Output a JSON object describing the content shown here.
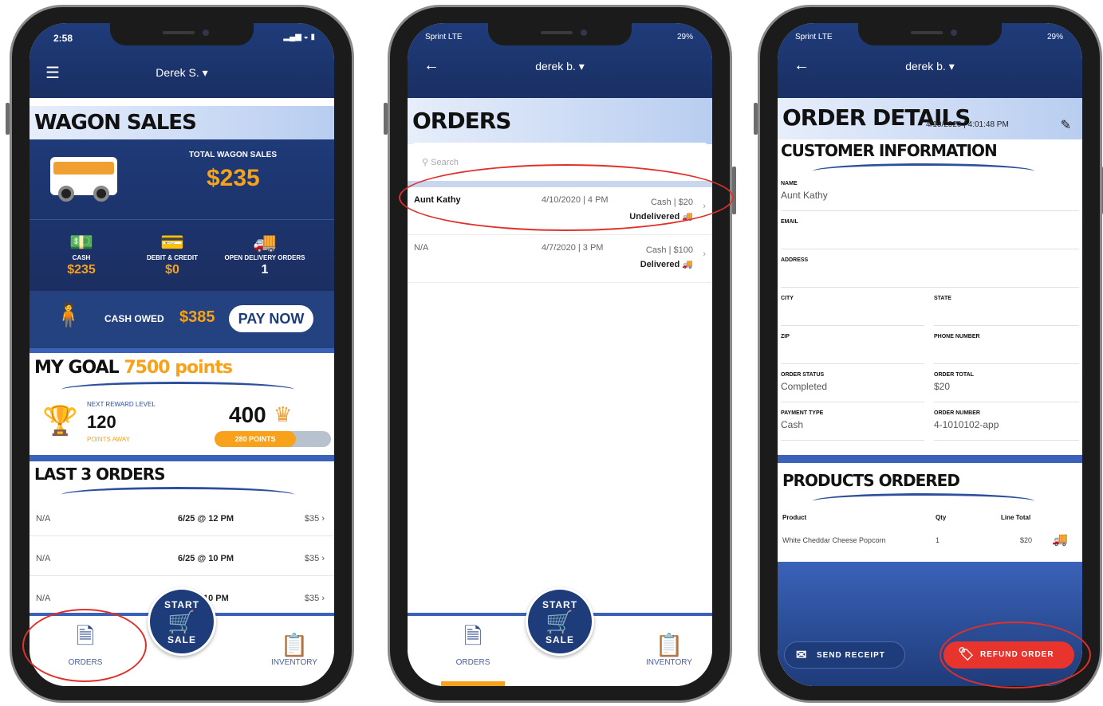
{
  "phone1": {
    "status_time": "2:58",
    "user_name": "Derek S. ▾",
    "menu_icon": "hamburger-icon",
    "wagon_title": "WAGON SALES",
    "total_label": "TOTAL WAGON SALES",
    "total_value": "$235",
    "stats": [
      {
        "icon": "cash-icon",
        "label": "CASH",
        "value": "$235"
      },
      {
        "icon": "card-icon",
        "label": "DEBIT & CREDIT",
        "value": "$0"
      },
      {
        "icon": "delivery-truck-icon",
        "label": "OPEN DELIVERY ORDERS",
        "value": "1"
      }
    ],
    "cash_owed_label": "CASH OWED",
    "cash_owed_value": "$385",
    "pay_now": "PAY NOW",
    "goal_title": "MY GOAL",
    "goal_points": "7500 points",
    "next_reward_label": "NEXT REWARD LEVEL",
    "next_reward_value": "120",
    "points_away": "POINTS AWAY",
    "points_total": "400",
    "progress_label": "280 POINTS",
    "progress_fraction": 0.7,
    "last_orders_title": "LAST 3 ORDERS",
    "last_orders": [
      {
        "name": "N/A",
        "time": "6/25 @ 12 PM",
        "amount": "$35"
      },
      {
        "name": "N/A",
        "time": "6/25 @ 10 PM",
        "amount": "$35"
      },
      {
        "name": "N/A",
        "time": "10 PM",
        "amount": "$35"
      }
    ],
    "nav_orders": "ORDERS",
    "nav_inventory": "INVENTORY",
    "fab_top": "START",
    "fab_bottom": "SALE"
  },
  "phone2": {
    "status_left": "Sprint LTE",
    "status_right": "29%",
    "user_name": "derek b. ▾",
    "title": "ORDERS",
    "search_placeholder": "Search",
    "orders": [
      {
        "name": "Aunt Kathy",
        "date": "4/10/2020 | 4 PM",
        "payment": "Cash | $20",
        "status": "Undelivered"
      },
      {
        "name": "N/A",
        "date": "4/7/2020 | 3 PM",
        "payment": "Cash | $100",
        "status": "Delivered"
      }
    ],
    "nav_orders": "ORDERS",
    "nav_inventory": "INVENTORY",
    "fab_top": "START",
    "fab_bottom": "SALE"
  },
  "phone3": {
    "status_left": "Sprint LTE",
    "status_right": "29%",
    "user_name": "derek b. ▾",
    "title": "ORDER DETAILS",
    "date": "4/10/2020 | 4:01:48 PM",
    "customer_title": "CUSTOMER INFORMATION",
    "fields": {
      "name_label": "NAME",
      "name_value": "Aunt Kathy",
      "email_label": "EMAIL",
      "email_value": "",
      "address_label": "ADDRESS",
      "address_value": "",
      "city_label": "CITY",
      "city_value": "",
      "state_label": "STATE",
      "state_value": "",
      "zip_label": "ZIP",
      "zip_value": "",
      "phone_label": "PHONE NUMBER",
      "phone_value": "",
      "status_label": "ORDER STATUS",
      "status_value": "Completed",
      "total_label": "ORDER TOTAL",
      "total_value": "$20",
      "paytype_label": "PAYMENT TYPE",
      "paytype_value": "Cash",
      "number_label": "ORDER NUMBER",
      "number_value": "4-1010102-app"
    },
    "products_title": "PRODUCTS ORDERED",
    "product_headers": {
      "product": "Product",
      "qty": "Qty",
      "line_total": "Line Total"
    },
    "products": [
      {
        "product": "White Cheddar Cheese Popcorn",
        "qty": "1",
        "line_total": "$20"
      }
    ],
    "send_receipt": "SEND RECEIPT",
    "refund_order": "REFUND ORDER"
  }
}
